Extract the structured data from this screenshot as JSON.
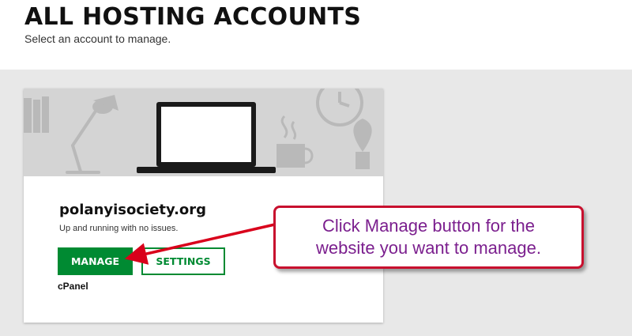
{
  "header": {
    "title": "ALL HOSTING ACCOUNTS",
    "subtitle": "Select an account to manage."
  },
  "account": {
    "domain": "polanyisociety.org",
    "status": "Up and running with no issues.",
    "manage_label": "MANAGE",
    "settings_label": "SETTINGS",
    "control_panel": "cPanel"
  },
  "callout": {
    "line1": "Click Manage button for the",
    "line2": "website you want to manage."
  },
  "colors": {
    "brand_green": "#008a32",
    "callout_border": "#c8102e",
    "callout_text": "#7b1f8e"
  },
  "icons": [
    "laptop-illustration",
    "desk-lamp-illustration",
    "clock-illustration",
    "coffee-mug-illustration",
    "arrow-pointer"
  ]
}
